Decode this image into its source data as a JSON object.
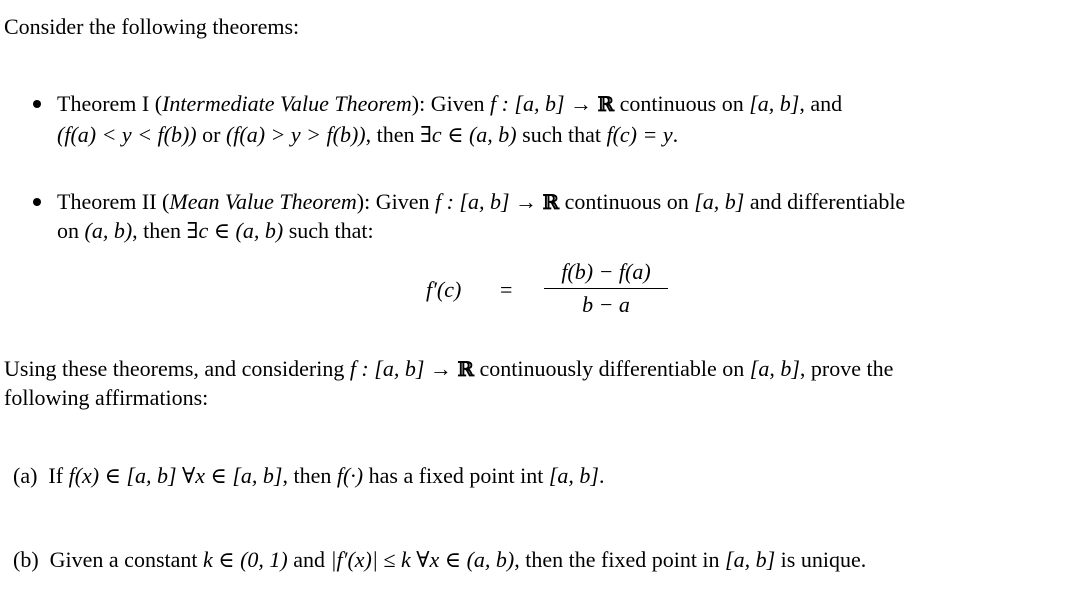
{
  "intro": "Consider the following theorems:",
  "theorem1": {
    "label": "Theorem I (",
    "name": "Intermediate Value Theorem",
    "after_name": "): Given ",
    "line1_math1": "f : [a, b] → ",
    "reals": "ℝ",
    "line1_rest": " continuous on ",
    "line1_math2": "[a, b]",
    "line1_end": ", and",
    "line2_math1": "(f(a) < y < f(b))",
    "line2_or": " or ",
    "line2_math2": "(f(a) > y > f(b))",
    "line2_then": ", then ",
    "line2_math3": "∃c ∈ (a, b)",
    "line2_such": " such that ",
    "line2_math4": "f(c) = y",
    "line2_end": "."
  },
  "theorem2": {
    "label": "Theorem II (",
    "name": "Mean Value Theorem",
    "after_name": "): Given ",
    "line1_math1": "f : [a, b] → ",
    "reals": "ℝ",
    "line1_rest": " continuous on ",
    "line1_math2": "[a, b]",
    "line1_end": " and differentiable",
    "line2_on": "on ",
    "line2_math1": "(a, b)",
    "line2_then": ", then ",
    "line2_math2": "∃c ∈ (a, b)",
    "line2_end": " such that:",
    "equation": {
      "lhs": "f′(c)",
      "eq": "=",
      "numerator": "f(b) − f(a)",
      "denominator": "b − a"
    }
  },
  "task": {
    "line1_start": "Using these theorems, and considering ",
    "line1_math1": "f : [a, b] → ",
    "reals": "ℝ",
    "line1_rest": " continuously differentiable on ",
    "line1_math2": "[a, b]",
    "line1_end": ", prove the",
    "line2": "following affirmations:"
  },
  "items": [
    {
      "label": "(a)",
      "t1": "If ",
      "m1": "f(x) ∈ [a, b] ∀x ∈ [a, b]",
      "t2": ", then ",
      "m2": "f(·)",
      "t3": " has a fixed point int ",
      "m3": "[a, b]",
      "t4": "."
    },
    {
      "label": "(b)",
      "t1": "Given a constant ",
      "m1": "k ∈ (0, 1)",
      "t2": " and ",
      "m2": "|f′(x)| ≤ k ∀x ∈ (a, b)",
      "t3": ", then the fixed point in ",
      "m3": "[a, b]",
      "t4": " is unique."
    }
  ]
}
